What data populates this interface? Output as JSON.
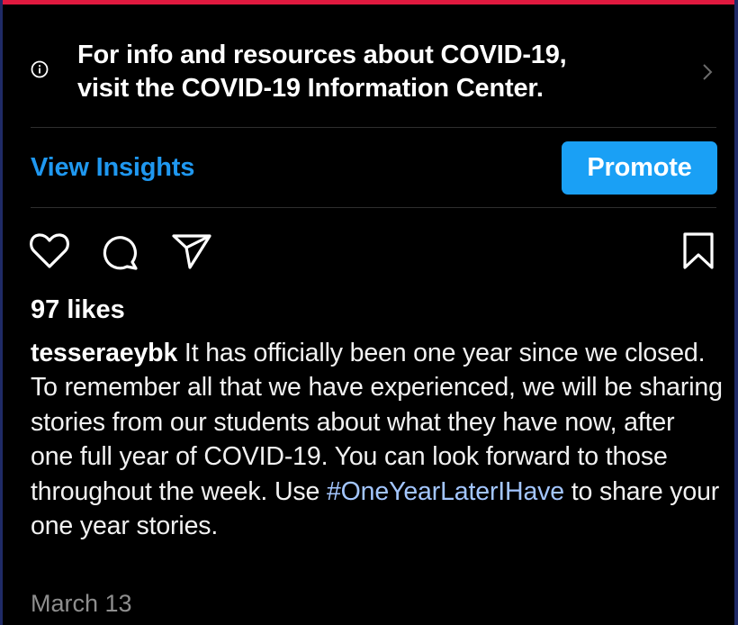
{
  "banner": {
    "text_line1": "For info and resources about COVID-19,",
    "text_line2": "visit the COVID-19 Information Center.",
    "icon": "info-circle-icon",
    "chevron_icon": "chevron-right-icon"
  },
  "actions_bar": {
    "view_insights_label": "View Insights",
    "promote_label": "Promote"
  },
  "post_actions": {
    "icons": [
      "heart-icon",
      "comment-icon",
      "share-icon",
      "bookmark-icon"
    ]
  },
  "post": {
    "likes": "97 likes",
    "username": "tesseraeybk",
    "caption_before": " It has officially been one year since we closed. To remember all that we have experienced, we will be sharing stories from our students about what they have now, after one full year of COVID-19. You can look forward to those throughout the week. Use ",
    "hashtag": "#OneYearLaterIHave",
    "caption_after": " to share your one year stories.",
    "date": "March 13"
  },
  "colors": {
    "background": "#000000",
    "link_blue": "#1f98f0",
    "button_blue": "#1aa0f5",
    "hashtag": "#a3c6ff",
    "muted": "#8e8e8e",
    "top_border": "#e0193f"
  }
}
